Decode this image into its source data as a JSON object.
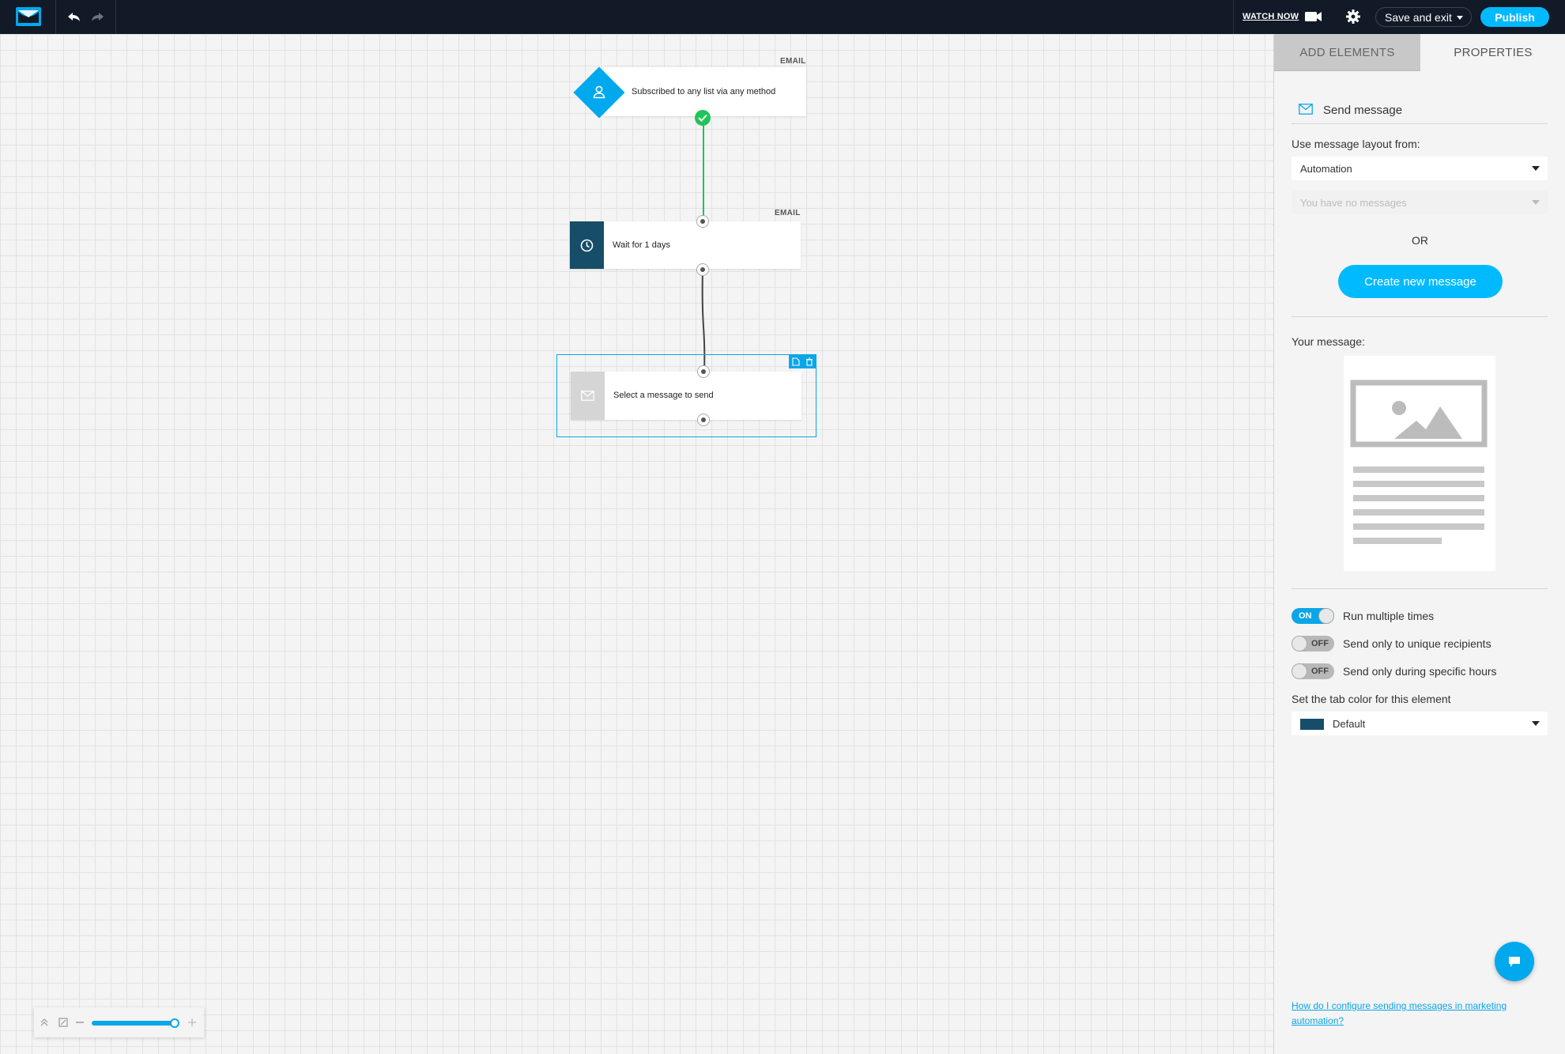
{
  "topbar": {
    "watch_now": "WATCH NOW",
    "save_and_exit": "Save and exit",
    "publish": "Publish"
  },
  "colors": {
    "accent": "#00baff",
    "topbar_bg": "#111a26",
    "success_green": "#1fc45a",
    "tab_color_default": "#164d68"
  },
  "workflow": {
    "nodes": [
      {
        "tag": "EMAIL",
        "label": "Subscribed to any list via any method",
        "icon": "user-icon"
      },
      {
        "tag": "EMAIL",
        "label": "Wait for 1 days",
        "icon": "clock-icon"
      },
      {
        "tag": "",
        "label": "Select a message to send",
        "icon": "envelope-icon"
      }
    ]
  },
  "zoom": {
    "level": 0.95
  },
  "panel": {
    "tabs": [
      "ADD ELEMENTS",
      "PROPERTIES"
    ],
    "active_tab": "PROPERTIES",
    "section_title": "Send message",
    "layout_label": "Use message layout from:",
    "layout_value": "Automation",
    "messages_placeholder": "You have no messages",
    "or": "OR",
    "create_button": "Create new message",
    "your_message": "Your message:",
    "toggles": [
      {
        "state": "ON",
        "label": "Run multiple times"
      },
      {
        "state": "OFF",
        "label": "Send only to unique recipients"
      },
      {
        "state": "OFF",
        "label": "Send only during specific hours"
      }
    ],
    "tab_color_label": "Set the tab color for this element",
    "tab_color_value": "Default",
    "help_link": "How do I configure sending messages in marketing automation?"
  }
}
